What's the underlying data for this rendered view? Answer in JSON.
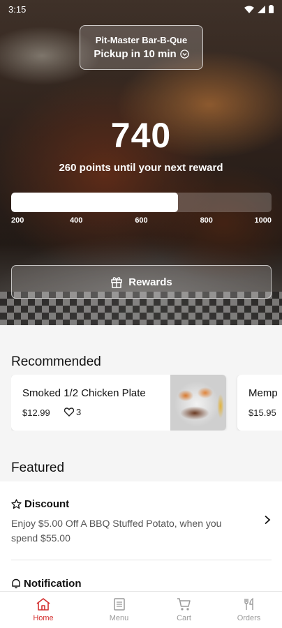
{
  "status_bar": {
    "time": "3:15"
  },
  "hero": {
    "store_name": "Pit-Master Bar-B-Que",
    "pickup_text": "Pickup in 10 min",
    "points": "740",
    "points_subtitle": "260 points until your next reward",
    "progress_fraction": 0.64,
    "progress_ticks": [
      "200",
      "400",
      "600",
      "800",
      "1000"
    ],
    "rewards_button": "Rewards"
  },
  "recommended": {
    "title": "Recommended",
    "items": [
      {
        "name": "Smoked 1/2 Chicken Plate",
        "price": "$12.99",
        "likes": "3"
      },
      {
        "name": "Memp",
        "price": "$15.95"
      }
    ]
  },
  "featured": {
    "title": "Featured",
    "items": [
      {
        "title": "Discount",
        "description": "Enjoy $5.00 Off A BBQ Stuffed Potato, when you spend $55.00",
        "icon": "star-outline-icon"
      },
      {
        "title": "Notification",
        "icon": "bell-icon"
      }
    ]
  },
  "bottom_nav": {
    "items": [
      {
        "label": "Home",
        "icon": "home-icon",
        "active": true
      },
      {
        "label": "Menu",
        "icon": "menu-icon",
        "active": false
      },
      {
        "label": "Cart",
        "icon": "cart-icon",
        "active": false
      },
      {
        "label": "Orders",
        "icon": "orders-icon",
        "active": false
      }
    ]
  },
  "colors": {
    "accent": "#d32f2f",
    "nav_inactive": "#9a9a9a"
  }
}
